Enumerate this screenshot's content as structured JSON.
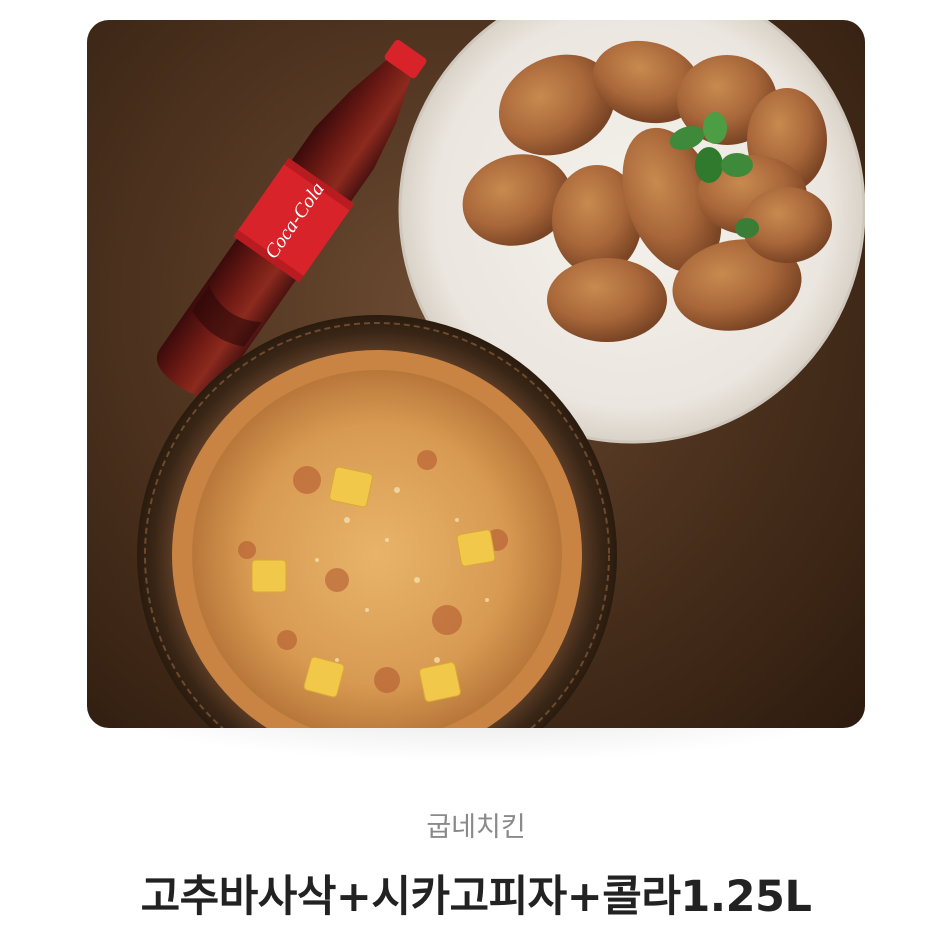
{
  "product": {
    "brand": "굽네치킨",
    "title": "고추바사삭+시카고피자+콜라1.25L",
    "image": {
      "bottle_label": "Coca-Cola",
      "icon_name": "food-product-image"
    }
  },
  "colors": {
    "background": "#ffffff",
    "brand_text": "#8a8a8a",
    "title_text": "#222222",
    "table_wood": "#4f3420",
    "coke_red": "#d8232a"
  }
}
